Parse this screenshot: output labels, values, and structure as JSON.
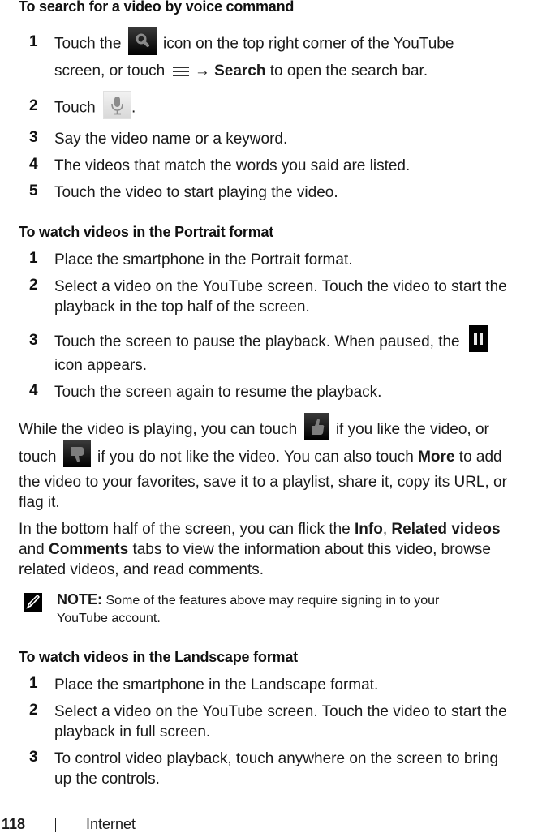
{
  "sections": {
    "voice_search": {
      "heading": "To search for a video by voice command",
      "steps": [
        {
          "num": "1",
          "line1_a": "Touch the",
          "line1_b": "icon on the top right corner of the YouTube",
          "line2_a": "screen, or touch",
          "line2_arrow": "→",
          "line2_bold": "Search",
          "line2_b": "to open the search bar."
        },
        {
          "num": "2",
          "text_a": "Touch",
          "text_b": "."
        },
        {
          "num": "3",
          "text": "Say the video name or a keyword."
        },
        {
          "num": "4",
          "text": "The videos that match the words you said are listed."
        },
        {
          "num": "5",
          "text": "Touch the video to start playing the video."
        }
      ]
    },
    "portrait": {
      "heading": "To watch videos in the Portrait format",
      "steps": [
        {
          "num": "1",
          "text": "Place the smartphone in the Portrait format."
        },
        {
          "num": "2",
          "line1": "Select a video on the YouTube screen. Touch the video to start the",
          "line2": "playback in the top half of the screen."
        },
        {
          "num": "3",
          "line1": "Touch the screen to pause the playback. When paused, the",
          "line2": "icon appears."
        },
        {
          "num": "4",
          "text": "Touch the screen again to resume the playback."
        }
      ]
    },
    "playing_para": {
      "l1_a": "While the video is playing, you can touch",
      "l1_b": "if you like the video, or",
      "l2_a": "touch",
      "l2_b": "if you do not like the video. You can also touch",
      "l2_bold": "More",
      "l2_c": "to add",
      "l3": "the video to your favorites, save it to a playlist, share it, copy its URL, or",
      "l4": "flag it."
    },
    "tabs_para": {
      "l1_a": "In the bottom half of the screen, you can flick the",
      "l1_bold1": "Info",
      "l1_sep": ",",
      "l1_bold2": "Related videos",
      "l2_a": "and",
      "l2_bold": "Comments",
      "l2_b": "tabs to view the information about this video, browse",
      "l3": "related videos, and read comments."
    },
    "note": {
      "label": "NOTE:",
      "l1": "Some of the features above may require signing in to your",
      "l2": "YouTube account."
    },
    "landscape": {
      "heading": "To watch videos in the Landscape format",
      "steps": [
        {
          "num": "1",
          "text": "Place the smartphone in the Landscape format."
        },
        {
          "num": "2",
          "line1": "Select a video on the YouTube screen. Touch the video to start the",
          "line2": "playback in full screen."
        },
        {
          "num": "3",
          "line1": "To control video playback, touch anywhere on the screen to bring",
          "line2": "up the controls."
        }
      ]
    }
  },
  "icons": {
    "search": "search-icon",
    "menu": "menu-icon",
    "microphone": "microphone-icon",
    "pause": "pause-icon",
    "thumbs_up": "thumbs-up-icon",
    "thumbs_down": "thumbs-down-icon",
    "note": "note-pencil-icon"
  },
  "footer": {
    "page_number": "118",
    "section": "Internet"
  }
}
